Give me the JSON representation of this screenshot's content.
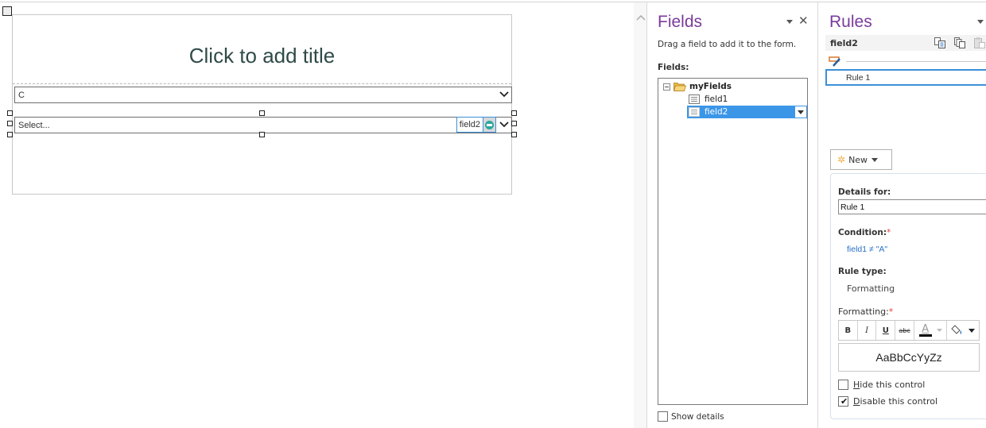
{
  "canvas": {
    "title_placeholder": "Click to add title",
    "dropdown1": {
      "value": "C"
    },
    "dropdown2": {
      "value": "Select...",
      "binding_tag": "field2",
      "binding_icon": "bound-field-icon"
    }
  },
  "fields_pane": {
    "title": "Fields",
    "description": "Drag a field to add it to the form.",
    "fields_label": "Fields:",
    "tree": {
      "root": {
        "label": "myFields",
        "expanded": true,
        "expander": "−"
      },
      "children": [
        {
          "label": "field1",
          "selected": false
        },
        {
          "label": "field2",
          "selected": true
        }
      ]
    },
    "show_details": {
      "label": "Show details",
      "checked": false
    }
  },
  "rules_pane": {
    "title": "Rules",
    "field_name": "field2",
    "toolbar_icons": [
      "copy-rule-icon",
      "copy-all-rules-icon",
      "paste-rule-icon"
    ],
    "rules": [
      {
        "label": "Rule 1",
        "selected": true
      }
    ],
    "new_button": {
      "label": "New"
    },
    "details": {
      "details_for_label": "Details for:",
      "details_for_value": "Rule 1",
      "condition_label": "Condition:",
      "condition_value": "field1 ≠ \"A\"",
      "rule_type_label": "Rule type:",
      "rule_type_value": "Formatting",
      "formatting_label": "Formatting:",
      "required_mark": "*",
      "format_buttons": {
        "bold": "B",
        "italic": "I",
        "underline": "U",
        "strike": "abc",
        "font_color": "A"
      },
      "preview_text": "AaBbCcYyZz",
      "hide_control": {
        "label_underlined": "H",
        "label_rest": "ide this control",
        "checked": false
      },
      "disable_control": {
        "label_underlined": "D",
        "label_rest": "isable this control",
        "checked": true
      }
    }
  },
  "colors": {
    "pane_title": "#7a3b9c",
    "selection": "#3c96e8",
    "focus_border": "#3c8fd8",
    "link": "#2a6fc8",
    "title_text": "#2f4a48"
  }
}
